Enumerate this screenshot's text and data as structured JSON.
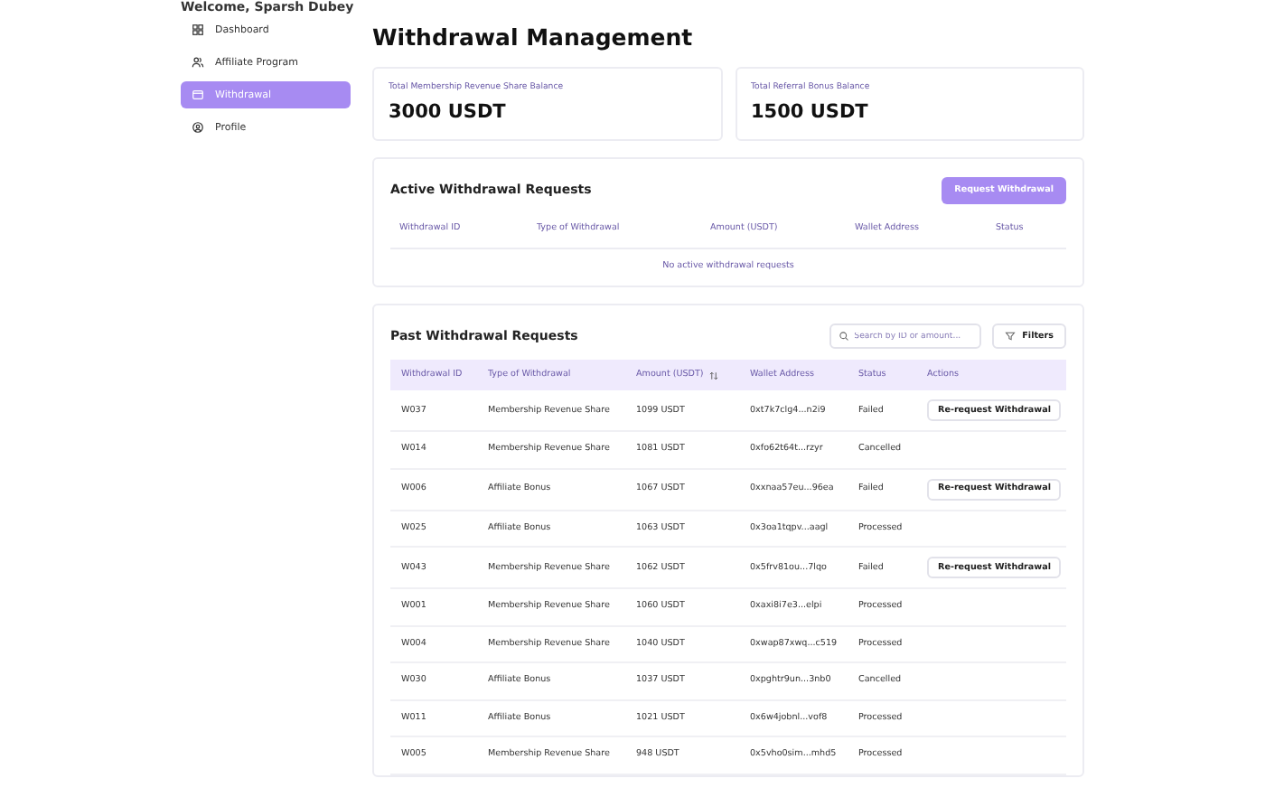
{
  "greeting": "Welcome, Sparsh Dubey",
  "sidebar": {
    "items": [
      {
        "label": "Dashboard",
        "selected": false
      },
      {
        "label": "Affiliate Program",
        "selected": false
      },
      {
        "label": "Withdrawal",
        "selected": true
      },
      {
        "label": "Profile",
        "selected": false
      }
    ]
  },
  "title": "Withdrawal Management",
  "balances": [
    {
      "label": "Total Membership Revenue Share Balance",
      "value": "3000 USDT"
    },
    {
      "label": "Total Referral Bonus Balance",
      "value": "1500 USDT"
    }
  ],
  "active": {
    "title": "Active Withdrawal Requests",
    "button": "Request Withdrawal",
    "columns": [
      "Withdrawal ID",
      "Type of Withdrawal",
      "Amount (USDT)",
      "Wallet Address",
      "Status"
    ],
    "empty": "No active withdrawal requests"
  },
  "past": {
    "title": "Past Withdrawal Requests",
    "search": {
      "placeholder": "Search by ID or amount..."
    },
    "filters": "Filters",
    "columns": [
      {
        "label": "Withdrawal ID",
        "sortable": false
      },
      {
        "label": "Type of Withdrawal",
        "sortable": false
      },
      {
        "label": "Amount (USDT)",
        "sortable": true
      },
      {
        "label": "Wallet Address",
        "sortable": false
      },
      {
        "label": "Status",
        "sortable": false
      },
      {
        "label": "Actions",
        "sortable": false
      }
    ],
    "rows": [
      {
        "id": "W037",
        "type": "Membership Revenue Share",
        "amount": "1099 USDT",
        "wallet": "0xt7k7clg4...n2i9",
        "status": "Failed",
        "action": "Re-request Withdrawal"
      },
      {
        "id": "W014",
        "type": "Membership Revenue Share",
        "amount": "1081 USDT",
        "wallet": "0xfo62t64t...rzyr",
        "status": "Cancelled"
      },
      {
        "id": "W006",
        "type": "Affiliate Bonus",
        "amount": "1067 USDT",
        "wallet": "0xxnaa57eu...96ea",
        "status": "Failed",
        "action": "Re-request Withdrawal"
      },
      {
        "id": "W025",
        "type": "Affiliate Bonus",
        "amount": "1063 USDT",
        "wallet": "0x3oa1tqpv...aagl",
        "status": "Processed"
      },
      {
        "id": "W043",
        "type": "Membership Revenue Share",
        "amount": "1062 USDT",
        "wallet": "0x5frv81ou...7lqo",
        "status": "Failed",
        "action": "Re-request Withdrawal"
      },
      {
        "id": "W001",
        "type": "Membership Revenue Share",
        "amount": "1060 USDT",
        "wallet": "0xaxi8i7e3...elpi",
        "status": "Processed"
      },
      {
        "id": "W004",
        "type": "Membership Revenue Share",
        "amount": "1040 USDT",
        "wallet": "0xwap87xwq...c519",
        "status": "Processed"
      },
      {
        "id": "W030",
        "type": "Affiliate Bonus",
        "amount": "1037 USDT",
        "wallet": "0xpghtr9un...3nb0",
        "status": "Cancelled"
      },
      {
        "id": "W011",
        "type": "Affiliate Bonus",
        "amount": "1021 USDT",
        "wallet": "0x6w4jobnl...vof8",
        "status": "Processed"
      },
      {
        "id": "W005",
        "type": "Membership Revenue Share",
        "amount": "948 USDT",
        "wallet": "0x5vho0sim...mhd5",
        "status": "Processed"
      }
    ]
  }
}
